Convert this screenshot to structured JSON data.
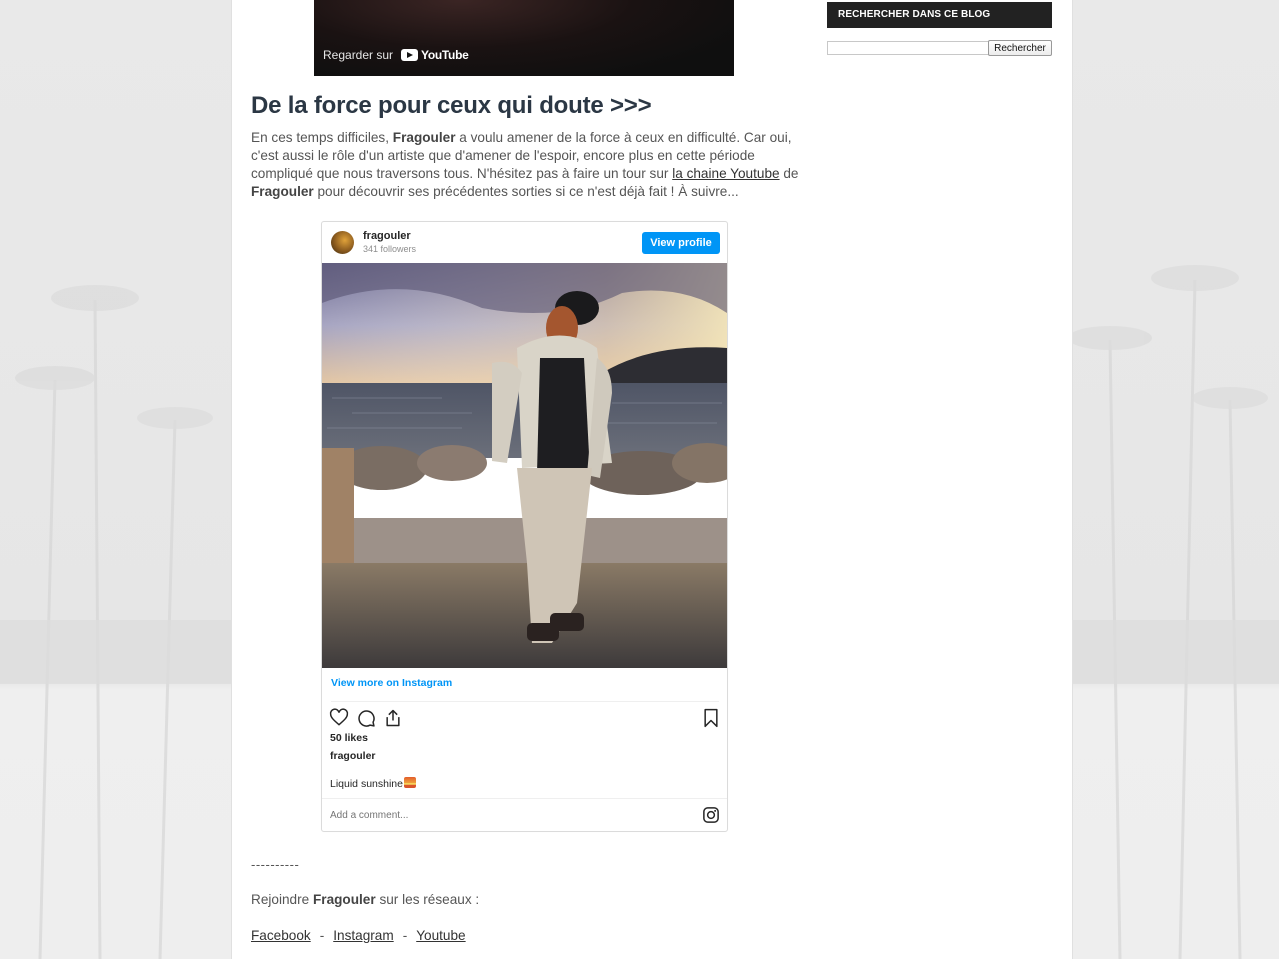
{
  "video": {
    "watch_label": "Regarder sur",
    "platform_label": "YouTube"
  },
  "post": {
    "title": "De la force pour ceux qui doute >>>",
    "body": {
      "p1_a": "En ces temps difficiles, ",
      "p1_artist": "Fragouler",
      "p1_b": " a voulu amener de la force à ceux en difficulté. Car oui, c'est aussi le rôle d'un artiste que d'amener de l'espoir, encore plus en cette période compliqué que nous traversons tous. N'hésitez pas à faire un tour sur ",
      "p1_link": "la chaine Youtube",
      "p1_c": " de ",
      "p1_artist2": "Fragouler",
      "p1_d": " pour découvrir ses précédentes sorties si ce n'est déjà fait ! À suivre..."
    },
    "separator": "----------",
    "join_a": "Rejoindre ",
    "join_artist": "Fragouler",
    "join_b": " sur les réseaux :",
    "socials": {
      "facebook": "Facebook",
      "instagram": "Instagram",
      "youtube": "Youtube",
      "separator": "-"
    }
  },
  "instagram_embed": {
    "username": "fragouler",
    "followers": "341 followers",
    "view_profile": "View profile",
    "view_more": "View more on Instagram",
    "likes": "50 likes",
    "caption_user": "fragouler",
    "caption": "Liquid sunshine",
    "comment_placeholder": "Add a comment...",
    "icons": [
      "heart-icon",
      "comment-icon",
      "share-icon",
      "bookmark-icon",
      "instagram-icon"
    ],
    "accent_color": "#0095f6"
  },
  "sidebar": {
    "search_heading": "RECHERCHER DANS CE BLOG",
    "search_button": "Rechercher",
    "search_value": ""
  }
}
